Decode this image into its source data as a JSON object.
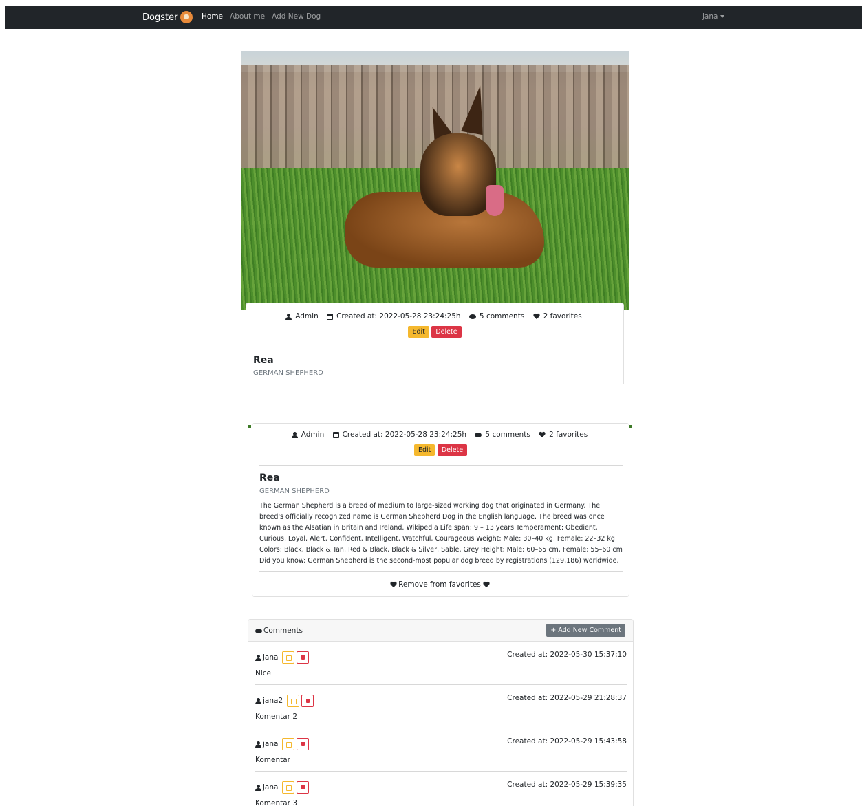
{
  "navbar": {
    "brand": "Dogster",
    "links": [
      "Home",
      "About me",
      "Add New Dog"
    ],
    "active_link": "Home",
    "user": "jana"
  },
  "dog": {
    "image_alt": "German Shepherd lying on grass",
    "author": "Admin",
    "created": "Created at: 2022-05-28 23:24:25h",
    "comments_count": "5 comments",
    "favorites_count": "2 favorites",
    "edit_label": "Edit",
    "delete_label": "Delete",
    "name": "Rea",
    "breed": "GERMAN SHEPHERD",
    "description": "The German Shepherd is a breed of medium to large-sized working dog that originated in Germany. The breed's officially recognized name is German Shepherd Dog in the English language. The breed was once known as the Alsatian in Britain and Ireland. Wikipedia Life span: 9 – 13 years Temperament: Obedient, Curious, Loyal, Alert, Confident, Intelligent, Watchful, Courageous Weight: Male: 30–40 kg, Female: 22–32 kg Colors: Black, Black & Tan, Red & Black, Black & Silver, Sable, Grey Height: Male: 60–65 cm, Female: 55–60 cm Did you know: German Shepherd is the second-most popular dog breed by registrations (129,186) worldwide.",
    "favorite_action": "Remove from favorites"
  },
  "comments": {
    "title": "Comments",
    "add_label": "+ Add New Comment",
    "items": [
      {
        "author": "jana",
        "created": "Created at: 2022-05-30 15:37:10",
        "text": "Nice"
      },
      {
        "author": "jana2",
        "created": "Created at: 2022-05-29 21:28:37",
        "text": "Komentar 2"
      },
      {
        "author": "jana",
        "created": "Created at: 2022-05-29 15:43:58",
        "text": "Komentar"
      },
      {
        "author": "jana",
        "created": "Created at: 2022-05-29 15:39:35",
        "text": "Komentar 3"
      }
    ]
  },
  "colors": {
    "navbar_bg": "#212529",
    "edit_yellow": "#f5b82e",
    "delete_red": "#dc3545",
    "secondary_gray": "#6c757d"
  }
}
